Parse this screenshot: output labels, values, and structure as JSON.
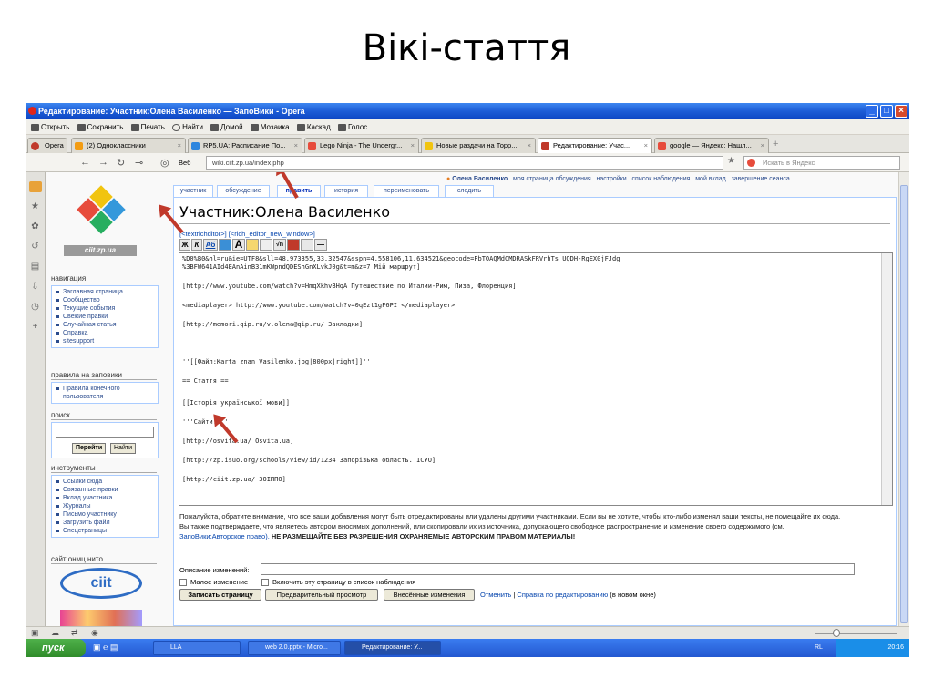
{
  "slide_title": "Вікі-стаття",
  "window": {
    "title": "Редактирование: Участник:Олена Василенко — ЗапоВики - Opera",
    "controls": [
      "_",
      "□",
      "×"
    ]
  },
  "menu": {
    "items": [
      "Открыть",
      "Сохранить",
      "Печать",
      "Найти",
      "Домой",
      "Мозаика",
      "Каскад",
      "Голос"
    ]
  },
  "tabs": {
    "opera_label": "Opera",
    "items": [
      {
        "label": "(2) Одноклассники",
        "color": "#f39c12"
      },
      {
        "label": "RP5.UA: Расписание По...",
        "color": "#2e86de"
      },
      {
        "label": "Lego Ninja - The Undergr...",
        "color": "#e74c3c"
      },
      {
        "label": "Новые раздачи на Торр...",
        "color": "#f1c40f"
      },
      {
        "label": "Редактирование: Учас...",
        "color": "#c0392b"
      },
      {
        "label": "google — Яндекс: Нашл...",
        "color": "#e74c3c"
      }
    ]
  },
  "address": {
    "web_label": "Веб",
    "url": "wiki.ciit.zp.ua/index.php",
    "search_placeholder": "Искать в Яндекс"
  },
  "userbar": {
    "user": "Олена Василенко",
    "links": [
      "моя страница обсуждения",
      "настройки",
      "список наблюдения",
      "мой вклад",
      "завершение сеанса"
    ]
  },
  "page_tabs": [
    "участник",
    "обсуждение",
    "править",
    "история",
    "переименовать",
    "следить"
  ],
  "logo_text": "ciit.zp.ua",
  "sidebar": {
    "nav_heading": "навигация",
    "nav_items": [
      "Заглавная страница",
      "Сообщество",
      "Текущие события",
      "Свежие правки",
      "Случайная статья",
      "Справка",
      "sitesupport"
    ],
    "rules_heading": "правила на заповики",
    "rules_items": [
      "Правила конечного пользователя"
    ],
    "search_heading": "поиск",
    "search_go": "Перейти",
    "search_find": "Найти",
    "tools_heading": "инструменты",
    "tools_items": [
      "Ссылки сюда",
      "Связанные правки",
      "Вклад участника",
      "Журналы",
      "Письмо участнику",
      "Загрузить файл",
      "Спецстраницы"
    ],
    "site_heading": "сайт онмц нито",
    "site_logo_text": "ciit"
  },
  "content": {
    "title": "Участник:Олена Василенко",
    "editor_links": "[<textrichditor>] [<rich_editor_new_window>]",
    "toolbar": [
      "Ж",
      "К",
      "Аб",
      "",
      "A",
      "",
      "",
      "√n",
      "",
      "",
      "—"
    ],
    "editor_lines": [
      "%D0%B0&hl=ru&ie=UTF8&sll=48.973355,33.32547&sspn=4.558106,11.634521&geocode=FbTOAQMdCMDRASkFRVrhTs_UQDH-RgEX0jFJdg",
      "%3BFW641AId4EAnAinB31mKWpndQDEShGnXLvkJ0g&t=m&z=7 Мій маршрут]",
      "[http://www.youtube.com/watch?v=HmqXkhvBHqA Путешествие по Италии-Рим, Пиза, Флоренция]",
      "<mediaplayer> http://www.youtube.com/watch?v=0qEzt1gF6PI </mediaplayer>",
      "[http://memori.qip.ru/v.olena@qip.ru/ Закладки]",
      "''[[Файл:Karta znan Vasilenko.jpg|800px|right]]''",
      "== Стаття ==",
      "[[Історія української мови]]",
      "'''Сайти:'''",
      "[http://osvita.ua/ Osvita.ua]",
      "[http://zp.isuo.org/schools/view/id/1234 Запорізька область. ІСУО]",
      "[http://ciit.zp.ua/ ЗОІППО]"
    ],
    "notice_1": "Пожалуйста, обратите внимание, что все ваши добавления могут быть отредактированы или удалены другими участниками. Если вы не хотите, чтобы кто-либо изменял ваши тексты, не помещайте их сюда.",
    "notice_2": "Вы также подтверждаете, что являетесь автором вносимых дополнений, или скопировали их из источника, допускающего свободное распространение и изменение своего содержимого (см.",
    "notice_link": "ЗапоВики:Авторское право).",
    "notice_warning": "НЕ РАЗМЕЩАЙТЕ БЕЗ РАЗРЕШЕНИЯ ОХРАНЯЕМЫЕ АВТОРСКИМ ПРАВОМ МАТЕРИАЛЫ!",
    "summary_label": "Описание изменений:",
    "minor_edit": "Малое изменение",
    "watch_page": "Включить эту страницу в список наблюдения",
    "save_button": "Записать страницу",
    "preview_button": "Предварительный просмотр",
    "diff_button": "Внесённые изменения",
    "cancel_link": "Отменить",
    "help_link": "Справка по редактированию",
    "help_suffix": "(в новом окне)"
  },
  "taskbar": {
    "start_label": "пуск",
    "tasks": [
      "LLA",
      "web 2.0.pptx - Micro...",
      "Редактирование: У..."
    ],
    "lang": "RL",
    "clock": "20:16"
  },
  "colors": {
    "accent": "#c0392b",
    "link": "#0645ad",
    "titlebar": "#1c5cd6"
  }
}
